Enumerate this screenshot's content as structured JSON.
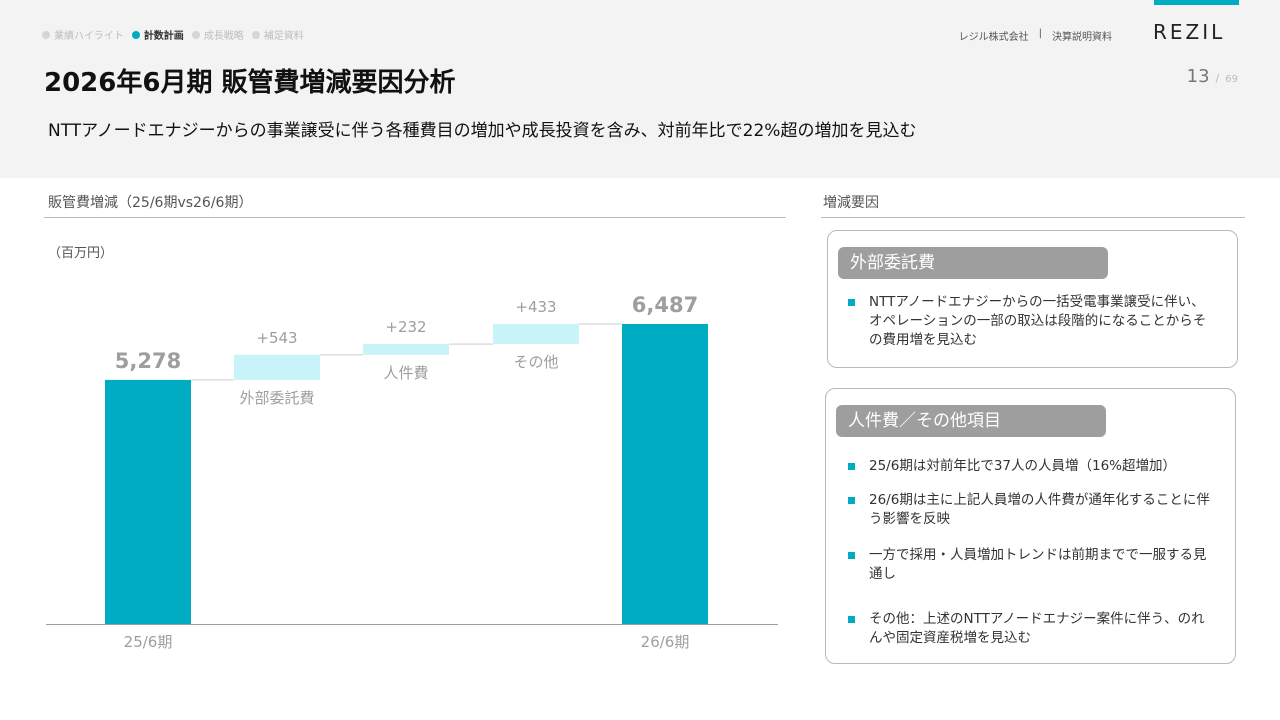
{
  "nav": [
    {
      "label": "業績ハイライト",
      "active": false
    },
    {
      "label": "計数計画",
      "active": true
    },
    {
      "label": "成長戦略",
      "active": false
    },
    {
      "label": "補足資料",
      "active": false
    }
  ],
  "corporate": {
    "company": "レジル株式会社",
    "separator": "|",
    "doc": "決算説明資料"
  },
  "logo": "REZIL",
  "page": {
    "title": "2026年6月期 販管費増減要因分析",
    "number": "13",
    "slash": "/",
    "total": "69"
  },
  "subtitle": "NTTアノードエナジーからの事業譲受に伴う各種費目の増加や成長投資を含み、対前年比で22%超の増加を見込む",
  "left_section": {
    "label": "販管費増減（25/6期vs26/6期）",
    "unit": "（百万円）"
  },
  "right_section": {
    "label": "増減要因"
  },
  "colors": {
    "total": "#00acc1",
    "increase": "#c8f3f9",
    "connector": "#dddddd",
    "axis": "#9e9e9e"
  },
  "chart_data": {
    "type": "waterfall",
    "unit": "百万円",
    "items": [
      {
        "label": "25/6期",
        "kind": "total",
        "value": 5278,
        "value_label": "5,278"
      },
      {
        "label": "外部委託費",
        "kind": "delta",
        "value": 543,
        "value_label": "+543"
      },
      {
        "label": "人件費",
        "kind": "delta",
        "value": 232,
        "value_label": "+232"
      },
      {
        "label": "その他",
        "kind": "delta",
        "value": 433,
        "value_label": "+433"
      },
      {
        "label": "26/6期",
        "kind": "total",
        "value": 6487,
        "value_label": "6,487"
      }
    ]
  },
  "boxes": [
    {
      "title": "外部委託費",
      "bullets": [
        "NTTアノードエナジーからの一括受電事業譲受に伴い、オペレーションの一部の取込は段階的になることからその費用増を見込む"
      ]
    },
    {
      "title": "人件費／その他項目",
      "bullets": [
        "25/6期は対前年比で37人の人員増（16%超増加）",
        "26/6期は主に上記人員増の人件費が通年化することに伴う影響を反映",
        "一方で採用・人員増加トレンドは前期までで一服する見通し",
        "その他：上述のNTTアノードエナジー案件に伴う、のれんや固定資産税増を見込む"
      ]
    }
  ]
}
